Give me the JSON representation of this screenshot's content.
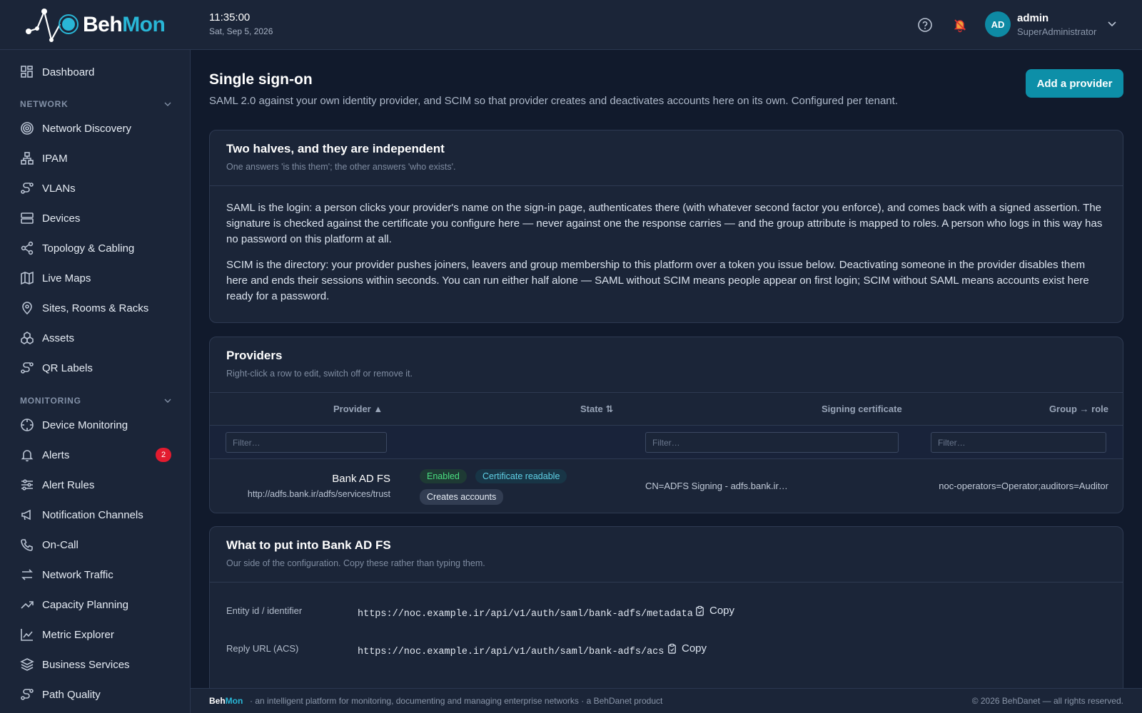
{
  "brand": {
    "part1": "Beh",
    "part2": "Mon"
  },
  "header": {
    "time": "11:35:00",
    "date": "Sat, Sep 5, 2026",
    "user_name": "admin",
    "user_role": "SuperAdministrator",
    "avatar_initials": "AD"
  },
  "sidebar": {
    "dashboard": "Dashboard",
    "network_header": "NETWORK",
    "network_items": [
      "Network Discovery",
      "IPAM",
      "VLANs",
      "Devices",
      "Topology & Cabling",
      "Live Maps",
      "Sites, Rooms & Racks",
      "Assets",
      "QR Labels"
    ],
    "monitoring_header": "MONITORING",
    "monitoring_items": [
      "Device Monitoring",
      "Alerts",
      "Alert Rules",
      "Notification Channels",
      "On-Call",
      "Network Traffic",
      "Capacity Planning",
      "Metric Explorer",
      "Business Services",
      "Path Quality"
    ],
    "alerts_badge": "2"
  },
  "page": {
    "title": "Single sign-on",
    "description": "SAML 2.0 against your own identity provider, and SCIM so that provider creates and deactivates accounts here on its own. Configured per tenant.",
    "add_button": "Add a provider"
  },
  "intro_card": {
    "title": "Two halves, and they are independent",
    "subtitle": "One answers 'is this them'; the other answers 'who exists'.",
    "paragraph1": "SAML is the login: a person clicks your provider's name on the sign-in page, authenticates there (with whatever second factor you enforce), and comes back with a signed assertion. The signature is checked against the certificate you configure here — never against one the response carries — and the group attribute is mapped to roles. A person who logs in this way has no password on this platform at all.",
    "paragraph2": "SCIM is the directory: your provider pushes joiners, leavers and group membership to this platform over a token you issue below. Deactivating someone in the provider disables them here and ends their sessions within seconds. You can run either half alone — SAML without SCIM means people appear on first login; SCIM without SAML means accounts exist here ready for a password."
  },
  "providers_card": {
    "title": "Providers",
    "subtitle": "Right-click a row to edit, switch off or remove it.",
    "columns": {
      "provider": "Provider ▲",
      "state": "State ⇅",
      "certificate": "Signing certificate",
      "group_role": "Group → role"
    },
    "filter_placeholder": "Filter…",
    "rows": [
      {
        "name": "Bank AD FS",
        "url": "http://adfs.bank.ir/adfs/services/trust",
        "state_enabled": "Enabled",
        "state_cert": "Certificate readable",
        "state_accounts": "Creates accounts",
        "certificate": "CN=ADFS Signing - adfs.bank.ir…",
        "group_role": "noc-operators=Operator;auditors=Auditor"
      }
    ]
  },
  "config_card": {
    "title": "What to put into Bank AD FS",
    "subtitle": "Our side of the configuration. Copy these rather than typing them.",
    "entity_label": "Entity id / identifier",
    "entity_value": "https://noc.example.ir/api/v1/auth/saml/bank-adfs/metadata",
    "reply_label": "Reply URL (ACS)",
    "reply_value": "https://noc.example.ir/api/v1/auth/saml/bank-adfs/acs",
    "copy_label": "Copy"
  },
  "footer": {
    "brand1": "Beh",
    "brand2": "Mon",
    "tagline": "·  an intelligent platform for monitoring, documenting and managing enterprise networks  ·  a BehDanet product",
    "copyright": "© 2026 BehDanet — all rights reserved."
  },
  "colors": {
    "accent": "#0d8fa8",
    "enabled_text": "#4ade80",
    "cert_text": "#5fd1e6",
    "badge": "#e31b2f"
  },
  "icons": [
    "help-icon",
    "bell-off-icon",
    "chevron-down-icon",
    "dashboard-icon",
    "copy-icon"
  ]
}
